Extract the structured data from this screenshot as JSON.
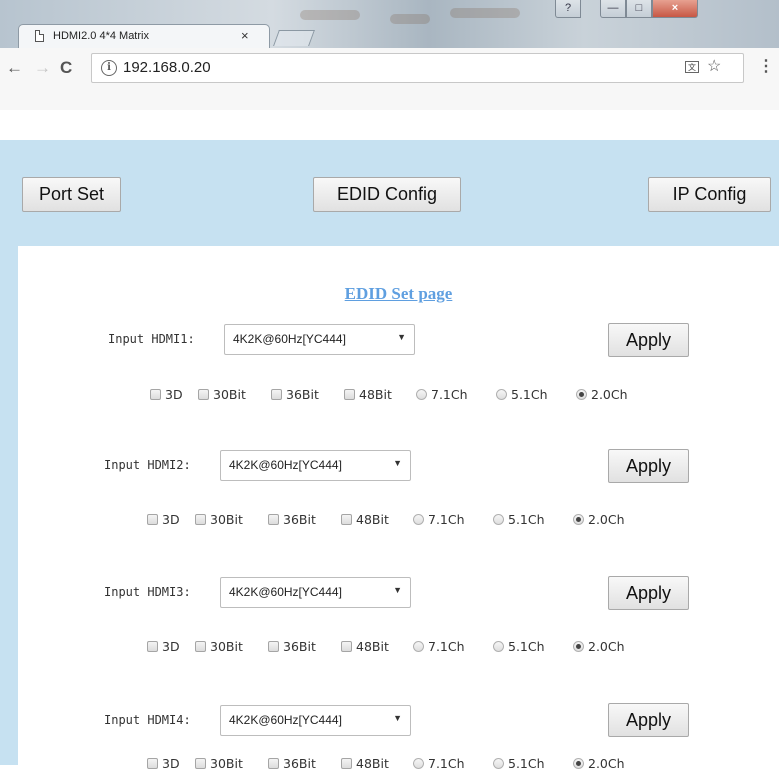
{
  "browser": {
    "tab_title": "HDMI2.0 4*4 Matrix",
    "tab_close": "×",
    "url": "192.168.0.20",
    "info_glyph": "i",
    "translate_glyph": "文",
    "star_glyph": "☆",
    "menu_glyph": "⋮",
    "back_glyph": "←",
    "forward_glyph": "→",
    "reload_glyph": "C",
    "help_glyph": "?",
    "minimize_glyph": "—",
    "maximize_glyph": "□",
    "close_glyph": "×"
  },
  "top_nav": {
    "port_set": "Port Set",
    "edid_config": "EDID Config",
    "ip_config": "IP Config"
  },
  "panel": {
    "title": "EDID Set page",
    "inputs": [
      {
        "label": "Input HDMI1:",
        "selected": "4K2K@60Hz[YC444]",
        "apply": "Apply"
      },
      {
        "label": "Input HDMI2:",
        "selected": "4K2K@60Hz[YC444]",
        "apply": "Apply"
      },
      {
        "label": "Input HDMI3:",
        "selected": "4K2K@60Hz[YC444]",
        "apply": "Apply"
      },
      {
        "label": "Input HDMI4:",
        "selected": "4K2K@60Hz[YC444]",
        "apply": "Apply"
      }
    ],
    "options": {
      "o3d": "3D",
      "b30": "30Bit",
      "b36": "36Bit",
      "b48": "48Bit",
      "ch71": "7.1Ch",
      "ch51": "5.1Ch",
      "ch20": "2.0Ch"
    },
    "selected_channel": "2.0Ch",
    "dropdown_arrow": "▼"
  },
  "colors": {
    "page_background": "#c6e1f1",
    "title_link": "#5f9fe0"
  }
}
